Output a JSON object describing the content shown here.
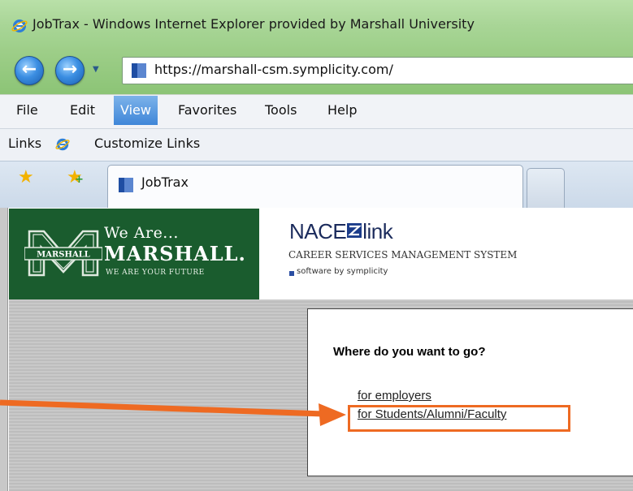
{
  "window": {
    "title": "JobTrax - Windows Internet Explorer provided by Marshall University"
  },
  "address": {
    "url": "https://marshall-csm.symplicity.com/"
  },
  "menu": {
    "items": [
      "File",
      "Edit",
      "View",
      "Favorites",
      "Tools",
      "Help"
    ],
    "active": "View"
  },
  "links_bar": {
    "label": "Links",
    "customize": "Customize Links"
  },
  "tab": {
    "title": "JobTrax"
  },
  "banner": {
    "logo_text": "MARSHALL",
    "we_are": "We Are...",
    "marshall": "MARSHALL.",
    "tagline": "WE ARE YOUR FUTURE"
  },
  "nace": {
    "logo_left": "NACE",
    "logo_right": "link",
    "subtitle": "CAREER SERVICES MANAGEMENT SYSTEM",
    "software_by": "software by symplicity"
  },
  "destination": {
    "heading": "Where do you want to go?",
    "links": [
      "for employers",
      "for Students/Alumni/Faculty"
    ]
  },
  "colors": {
    "accent_orange": "#ee6a22",
    "marshall_green": "#1a5c2e",
    "ie_chrome_green": "#a8d596"
  },
  "icons": {
    "browser": "ie-icon",
    "back": "back-arrow-icon",
    "forward": "forward-arrow-icon",
    "favorites": "star-icon",
    "add_favorite": "star-plus-icon"
  }
}
